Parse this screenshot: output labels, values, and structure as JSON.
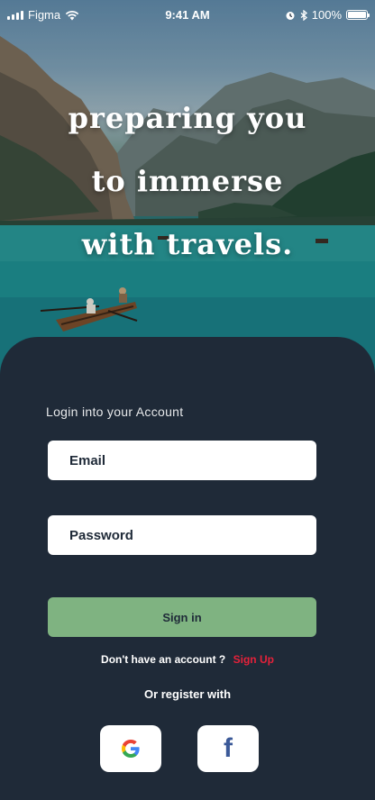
{
  "status_bar": {
    "carrier": "Figma",
    "time": "9:41 AM",
    "battery": "100%"
  },
  "hero": {
    "headline_lines": [
      "preparing you",
      "to immerse",
      "with travels."
    ]
  },
  "login": {
    "title": "Login into your Account",
    "email_placeholder": "Email",
    "password_placeholder": "Password",
    "signin_label": "Sign in",
    "no_account_text": "Don't have an account ?",
    "signup_link": "Sign Up",
    "register_with": "Or register with"
  },
  "social": {
    "google_icon": "google-icon",
    "facebook_icon": "facebook-icon",
    "facebook_glyph": "f"
  },
  "colors": {
    "card_bg": "#1f2a38",
    "accent_green": "#7fb381",
    "signup_red": "#e5213a",
    "facebook_blue": "#3b5998"
  }
}
